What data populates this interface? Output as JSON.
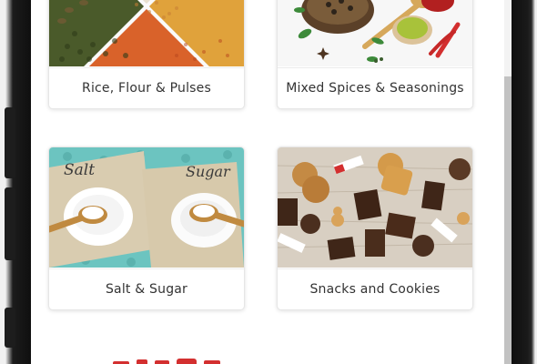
{
  "categories": [
    {
      "label": "Rice, Flour & Pulses",
      "icon": "grains-image"
    },
    {
      "label": "Mixed Spices & Seasonings",
      "icon": "spices-image"
    },
    {
      "label": "Salt & Sugar",
      "icon": "salt-sugar-image"
    },
    {
      "label": "Snacks and Cookies",
      "icon": "snacks-image"
    }
  ],
  "salt_sugar_image": {
    "salt_text": "Salt",
    "sugar_text": "Sugar"
  },
  "colors": {
    "accent_red": "#d32f2f",
    "teal_background": "#6cc4c0",
    "label_text": "#333333"
  }
}
